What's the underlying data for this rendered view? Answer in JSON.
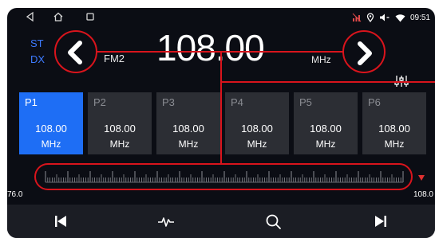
{
  "status_bar": {
    "time": "09:51",
    "nav_icons": [
      "back-icon",
      "home-icon",
      "recent-apps-icon"
    ],
    "status_icons": [
      "signal-off-icon",
      "location-icon",
      "volume-icon",
      "wifi-icon"
    ]
  },
  "tuner": {
    "stereo_label": "ST",
    "dx_label": "DX",
    "band": "FM2",
    "frequency": "108.00",
    "unit": "MHz",
    "scale_min": "76.0",
    "scale_max": "108.0"
  },
  "presets": [
    {
      "label": "P1",
      "freq": "108.00",
      "unit": "MHz",
      "active": true
    },
    {
      "label": "P2",
      "freq": "108.00",
      "unit": "MHz",
      "active": false
    },
    {
      "label": "P3",
      "freq": "108.00",
      "unit": "MHz",
      "active": false
    },
    {
      "label": "P4",
      "freq": "108.00",
      "unit": "MHz",
      "active": false
    },
    {
      "label": "P5",
      "freq": "108.00",
      "unit": "MHz",
      "active": false
    },
    {
      "label": "P6",
      "freq": "108.00",
      "unit": "MHz",
      "active": false
    }
  ],
  "toolbar": {
    "icons": [
      "skip-previous-icon",
      "scan-icon",
      "search-icon",
      "skip-next-icon"
    ]
  },
  "colors": {
    "background": "#0b0d14",
    "accent_blue": "#1e6ef5",
    "mode_blue": "#3d7bff",
    "preset_bg": "#2c2e34",
    "annotation_red": "#d9141c"
  }
}
